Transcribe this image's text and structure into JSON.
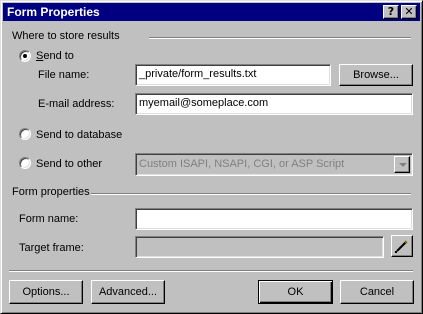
{
  "window": {
    "title": "Form Properties",
    "help_glyph": "?",
    "close_glyph": "✕"
  },
  "store_group": {
    "label": "Where to store results",
    "send_to": {
      "label": "Send to",
      "selected": true,
      "file_name": {
        "label": "File name:",
        "value": "_private/form_results.txt"
      },
      "browse_label": "Browse...",
      "email": {
        "label": "E-mail address:",
        "value": "myemail@someplace.com"
      }
    },
    "send_to_database": {
      "label": "Send to database",
      "selected": false
    },
    "send_to_other": {
      "label": "Send to other",
      "selected": false,
      "dropdown_value": "Custom ISAPI, NSAPI, CGI, or ASP Script"
    }
  },
  "form_props_group": {
    "label": "Form properties",
    "form_name": {
      "label": "Form name:",
      "value": ""
    },
    "target_frame": {
      "label": "Target frame:",
      "value": ""
    }
  },
  "buttons": {
    "options": "Options...",
    "advanced": "Advanced...",
    "ok": "OK",
    "cancel": "Cancel"
  },
  "colors": {
    "titlebar": "#000080",
    "face": "#c0c0c0"
  },
  "icons": {
    "target_frame_button": "pencil-icon"
  }
}
